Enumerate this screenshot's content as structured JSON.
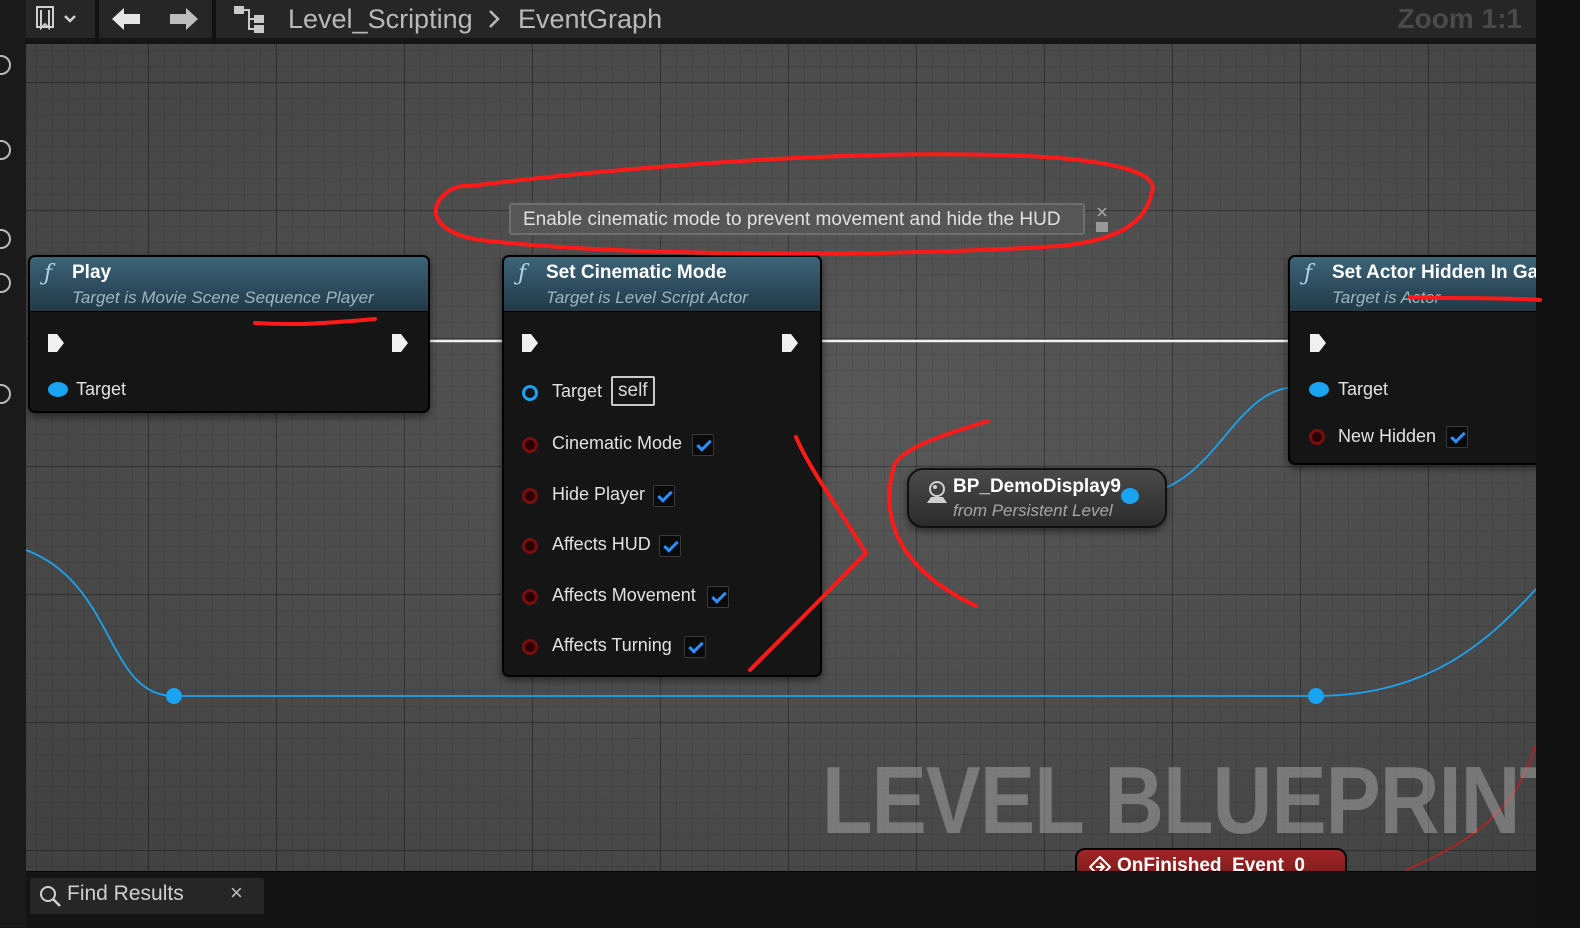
{
  "toolbar": {
    "breadcrumb_root": "Level_Scripting",
    "breadcrumb_leaf": "EventGraph",
    "zoom": "Zoom 1:1"
  },
  "comment": "Enable cinematic mode to prevent movement and hide the HUD",
  "nodes": {
    "play": {
      "title": "Play",
      "subtitle": "Target is Movie Scene Sequence Player",
      "pins": {
        "target": "Target"
      }
    },
    "set_cinematic": {
      "title": "Set Cinematic Mode",
      "subtitle": "Target is Level Script Actor",
      "pins": {
        "target": "Target",
        "target_default": "self",
        "cinematic_mode": "Cinematic Mode",
        "hide_player": "Hide Player",
        "affects_hud": "Affects HUD",
        "affects_movement": "Affects Movement",
        "affects_turning": "Affects Turning"
      },
      "checked": {
        "cinematic_mode": true,
        "hide_player": true,
        "affects_hud": true,
        "affects_movement": true,
        "affects_turning": true
      }
    },
    "set_actor_hidden": {
      "title": "Set Actor Hidden In Gar",
      "subtitle": "Target is Actor",
      "pins": {
        "target": "Target",
        "new_hidden": "New Hidden"
      },
      "checked": {
        "new_hidden": true
      }
    },
    "demo_display": {
      "title": "BP_DemoDisplay9",
      "subtitle": "from Persistent Level"
    },
    "on_finished": {
      "title": "OnFinished_Event_0"
    }
  },
  "watermark": "LEVEL BLUEPRINT",
  "find_results": {
    "label": "Find Results",
    "close": "×"
  },
  "colors": {
    "exec_wire": "#ffffff",
    "object_wire": "#1aa3f0",
    "annotation": "#ff1a1a",
    "node_header": "#2f5062",
    "event_header": "#8b1c1c"
  },
  "icons": [
    "bookmark-icon",
    "chevron-down-icon",
    "back-arrow-icon",
    "forward-arrow-icon",
    "graph-icon",
    "chevron-right-icon",
    "function-icon",
    "actor-icon",
    "event-icon",
    "search-icon",
    "close-icon"
  ]
}
